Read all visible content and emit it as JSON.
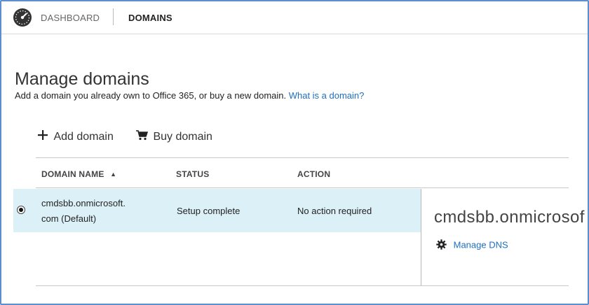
{
  "nav": {
    "dashboard_label": "DASHBOARD",
    "domains_label": "DOMAINS"
  },
  "page": {
    "title": "Manage domains",
    "intro_text": "Add a domain you already own to Office 365, or buy a new domain. ",
    "intro_link": "What is a domain?"
  },
  "toolbar": {
    "add_label": "Add domain",
    "buy_label": "Buy domain"
  },
  "table": {
    "columns": [
      "DOMAIN NAME",
      "STATUS",
      "ACTION"
    ],
    "sort_indicator": "▲",
    "rows": [
      {
        "domain_line1": "cmdsbb.onmicrosoft.",
        "domain_line2": "com (Default)",
        "status": "Setup complete",
        "action": "No action required",
        "selected": true
      }
    ]
  },
  "detail": {
    "title": "cmdsbb.onmicrosoft.com",
    "manage_dns_label": "Manage DNS"
  },
  "icons": {
    "dashboard": "speedometer-icon",
    "add": "plus-icon",
    "buy": "cart-icon",
    "dns": "gear-icon"
  },
  "colors": {
    "link": "#1e6fbf",
    "selected_row": "#dcf0f7",
    "frame": "#5b8fd1"
  }
}
